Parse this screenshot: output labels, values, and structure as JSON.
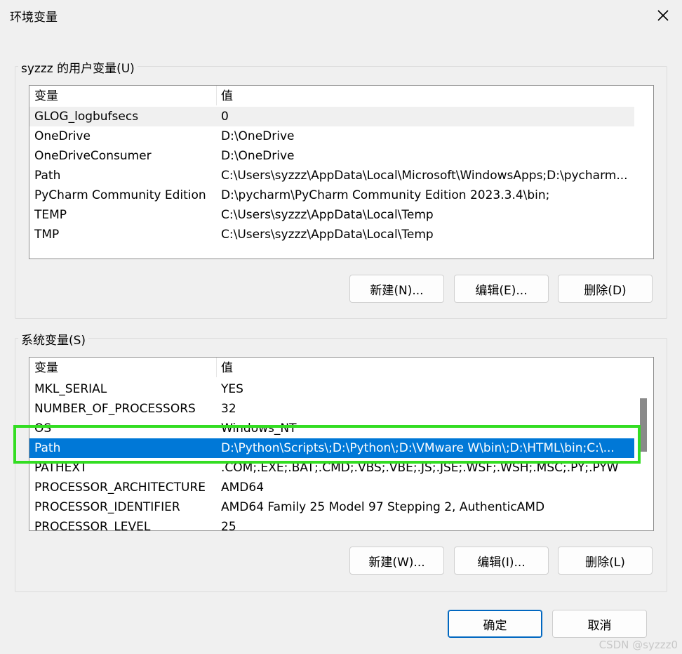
{
  "window": {
    "title": "环境变量"
  },
  "user_group": {
    "label": "syzzz 的用户变量(U)",
    "headers": {
      "name": "变量",
      "value": "值"
    },
    "rows": [
      {
        "name": "GLOG_logbufsecs",
        "value": "0"
      },
      {
        "name": "OneDrive",
        "value": "D:\\OneDrive"
      },
      {
        "name": "OneDriveConsumer",
        "value": "D:\\OneDrive"
      },
      {
        "name": "Path",
        "value": "C:\\Users\\syzzz\\AppData\\Local\\Microsoft\\WindowsApps;D:\\pycharm..."
      },
      {
        "name": "PyCharm Community Edition",
        "value": "D:\\pycharm\\PyCharm Community Edition 2023.3.4\\bin;"
      },
      {
        "name": "TEMP",
        "value": "C:\\Users\\syzzz\\AppData\\Local\\Temp"
      },
      {
        "name": "TMP",
        "value": "C:\\Users\\syzzz\\AppData\\Local\\Temp"
      }
    ],
    "buttons": {
      "new": "新建(N)...",
      "edit": "编辑(E)...",
      "delete": "删除(D)"
    }
  },
  "system_group": {
    "label": "系统变量(S)",
    "headers": {
      "name": "变量",
      "value": "值"
    },
    "rows": [
      {
        "name": "MKL_SERIAL",
        "value": "YES"
      },
      {
        "name": "NUMBER_OF_PROCESSORS",
        "value": "32"
      },
      {
        "name": "OS",
        "value": "Windows_NT"
      },
      {
        "name": "Path",
        "value": "D:\\Python\\Scripts\\;D:\\Python\\;D:\\VMware W\\bin\\;D:\\HTML\\bin;C:\\..."
      },
      {
        "name": "PATHEXT",
        "value": ".COM;.EXE;.BAT;.CMD;.VBS;.VBE;.JS;.JSE;.WSF;.WSH;.MSC;.PY;.PYW"
      },
      {
        "name": "PROCESSOR_ARCHITECTURE",
        "value": "AMD64"
      },
      {
        "name": "PROCESSOR_IDENTIFIER",
        "value": "AMD64 Family 25 Model 97 Stepping 2, AuthenticAMD"
      },
      {
        "name": "PROCESSOR_LEVEL",
        "value": "25"
      }
    ],
    "selected_row": "Path",
    "buttons": {
      "new": "新建(W)...",
      "edit": "编辑(I)...",
      "delete": "删除(L)"
    }
  },
  "footer": {
    "ok": "确定",
    "cancel": "取消"
  },
  "watermark": "CSDN @syzzz0",
  "colors": {
    "selection": "#0078d7",
    "highlight": "#33dd22"
  }
}
